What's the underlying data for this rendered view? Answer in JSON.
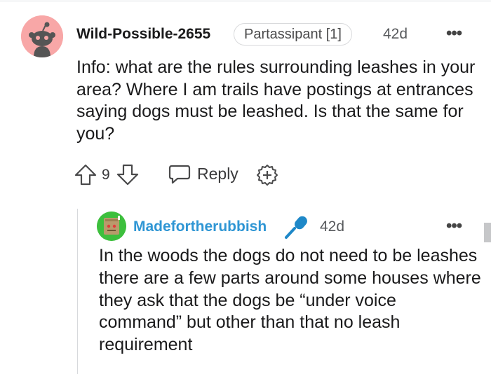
{
  "comment": {
    "username": "Wild-Possible-2655",
    "flair": "Partassipant [1]",
    "time": "42d",
    "more": "•••",
    "body": "Info: what are the rules surrounding leashes in your area? Where I am trails have postings at entrances saying dogs must be leashed. Is that the same for you?",
    "votes": "9",
    "reply_label": "Reply"
  },
  "reply": {
    "username": "Madefortherubbish",
    "time": "42d",
    "more": "•••",
    "body": "In the woods the dogs do not need to be leashes there are a few parts around some houses where they ask that the dogs be “under voice command” but other than that no leash requirement"
  },
  "colors": {
    "reply_username": "#2f96d4",
    "mic_icon": "#1e88c8",
    "avatar1_bg": "#f8a7a7",
    "avatar2_bg": "#3dbf3d"
  },
  "icons": [
    "reddit-avatar-icon",
    "upvote-icon",
    "downvote-icon",
    "reply-icon",
    "award-icon",
    "microphone-icon",
    "more-options-icon"
  ]
}
